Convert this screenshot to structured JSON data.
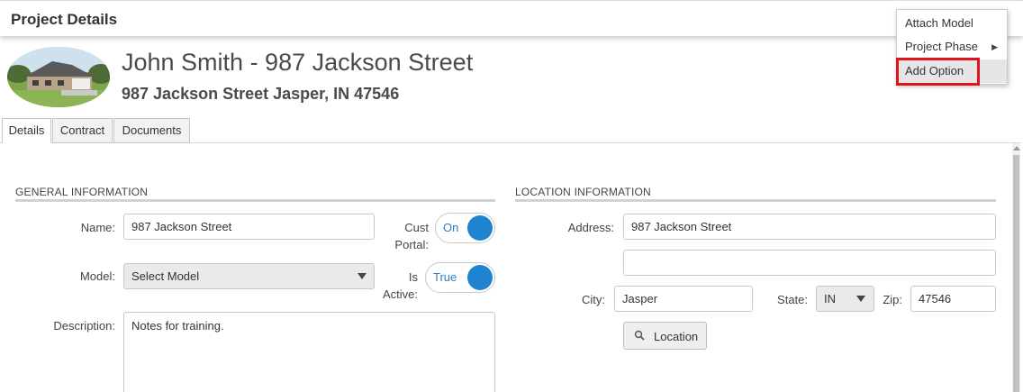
{
  "topbar": {
    "title": "Project Details"
  },
  "menu": {
    "items": [
      {
        "label": "Attach Model"
      },
      {
        "label": "Project Phase",
        "has_submenu": true
      },
      {
        "label": "Add Option",
        "highlighted": true
      }
    ],
    "submenu_arrow": "▶"
  },
  "project": {
    "title": "John Smith - 987 Jackson Street",
    "address": "987 Jackson Street Jasper, IN 47546",
    "avatar_icon": "house-photo"
  },
  "tabs": [
    {
      "label": "Details",
      "active": true
    },
    {
      "label": "Contract",
      "active": false
    },
    {
      "label": "Documents",
      "active": false
    }
  ],
  "general": {
    "title": "GENERAL INFORMATION",
    "name_label": "Name:",
    "name_value": "987 Jackson Street",
    "model_label": "Model:",
    "model_value": "Select Model",
    "description_label": "Description:",
    "description_value": "Notes for training.",
    "cust_portal_label_1": "Cust",
    "cust_portal_label_2": "Portal:",
    "cust_portal_value": "On",
    "is_active_label_1": "Is",
    "is_active_label_2": "Active:",
    "is_active_value": "True"
  },
  "location": {
    "title": "LOCATION INFORMATION",
    "address_label": "Address:",
    "address_line1": "987 Jackson Street",
    "address_line2": "",
    "city_label": "City:",
    "city_value": "Jasper",
    "state_label": "State:",
    "state_value": "IN",
    "zip_label": "Zip:",
    "zip_value": "47546",
    "location_button": "Location"
  },
  "colors": {
    "highlight_red": "#e0141e",
    "toggle_blue": "#1e84d0"
  }
}
